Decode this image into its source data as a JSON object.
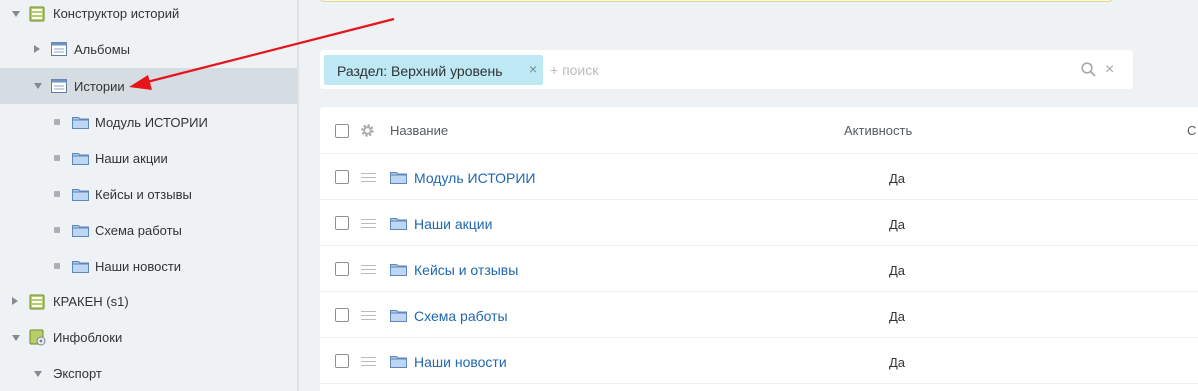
{
  "sidebar": {
    "items": [
      {
        "label": "Конструктор историй"
      },
      {
        "label": "Альбомы"
      },
      {
        "label": "Истории"
      },
      {
        "label": "Модуль ИСТОРИИ"
      },
      {
        "label": "Наши акции"
      },
      {
        "label": "Кейсы и отзывы"
      },
      {
        "label": "Схема работы"
      },
      {
        "label": "Наши новости"
      },
      {
        "label": "КРАКЕН (s1)"
      },
      {
        "label": "Инфоблоки"
      },
      {
        "label": "Экспорт"
      }
    ]
  },
  "filter": {
    "tag_label": "Раздел: Верхний уровень",
    "tag_remove": "×",
    "search_placeholder": "+ поиск",
    "clear": "×"
  },
  "grid": {
    "columns": [
      "Название",
      "Активность",
      "С"
    ],
    "rows": [
      {
        "name": "Модуль ИСТОРИИ",
        "active": "Да"
      },
      {
        "name": "Наши акции",
        "active": "Да"
      },
      {
        "name": "Кейсы и отзывы",
        "active": "Да"
      },
      {
        "name": "Схема работы",
        "active": "Да"
      },
      {
        "name": "Наши новости",
        "active": "Да"
      }
    ]
  },
  "colors": {
    "accent_link": "#2067b0",
    "tag_bg": "#bde8f4",
    "annotation_arrow": "#e8141b"
  },
  "icons": {
    "section": "green-book-icon",
    "iblock": "table-window-icon",
    "folder": "folder-icon"
  }
}
